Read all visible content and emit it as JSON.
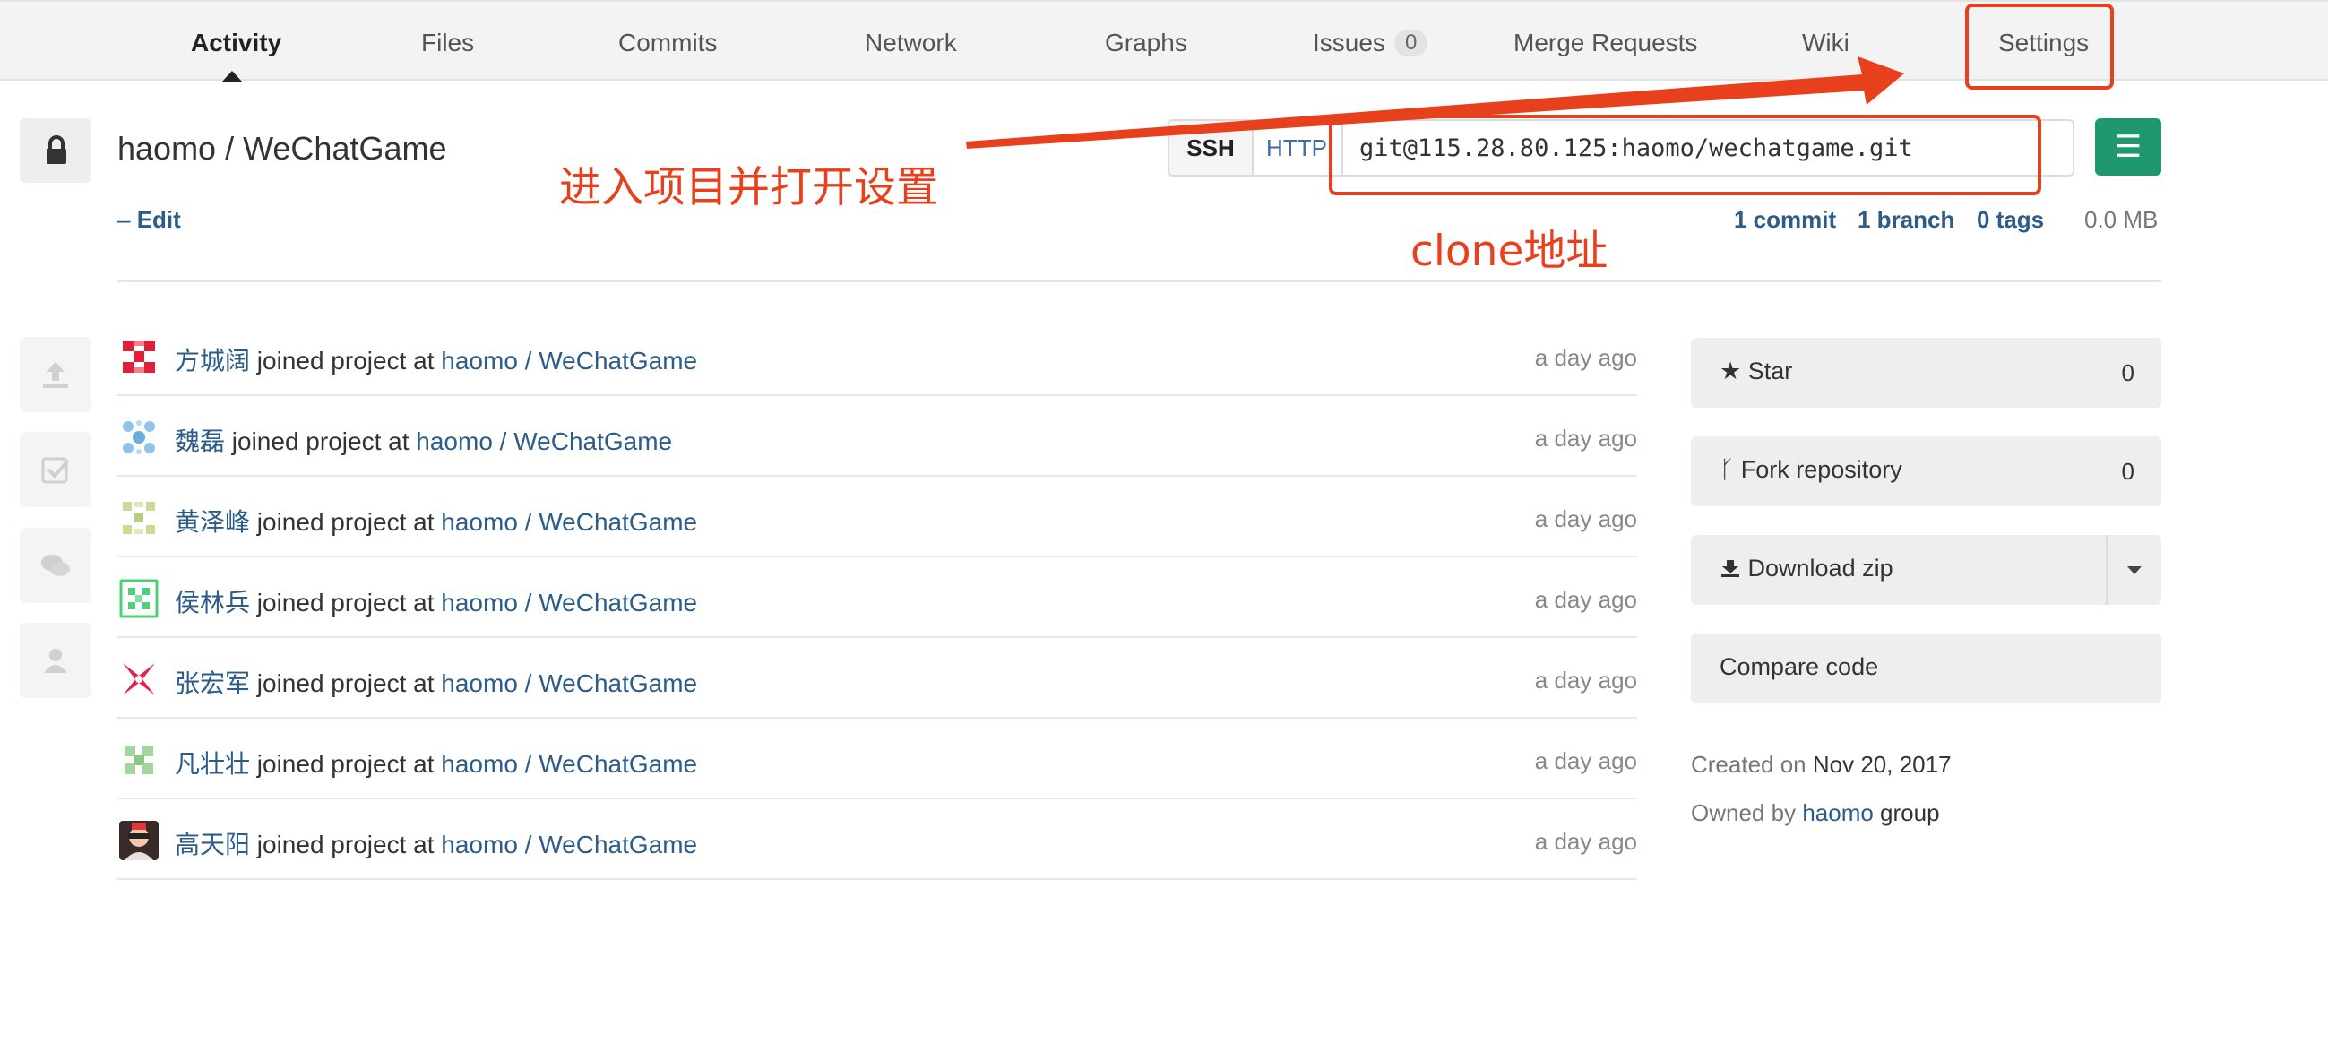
{
  "nav": {
    "tabs": [
      "Activity",
      "Files",
      "Commits",
      "Network",
      "Graphs",
      "Issues",
      "Merge Requests",
      "Wiki",
      "Settings"
    ],
    "active": "Activity",
    "issues_count": "0"
  },
  "project": {
    "title": "haomo / WeChatGame",
    "edit_dash": "–",
    "edit_label": "Edit"
  },
  "clone": {
    "ssh_label": "SSH",
    "http_label": "HTTP",
    "url": "git@115.28.80.125:haomo/wechatgame.git",
    "menu_icon": "☰"
  },
  "stats": {
    "commits": "1 commit",
    "branches": "1 branch",
    "tags": "0 tags",
    "size": "0.0 MB"
  },
  "annotations": {
    "open_settings": "进入项目并打开设置",
    "clone_address": "clone地址",
    "color": "#e8401c"
  },
  "sidebar_icons": [
    "upload-icon",
    "check-square-icon",
    "comments-icon",
    "user-icon"
  ],
  "events": [
    {
      "user": "方城阔",
      "action": "joined project",
      "at": "at",
      "project": "haomo / WeChatGame",
      "time": "a day ago"
    },
    {
      "user": "魏磊",
      "action": "joined project",
      "at": "at",
      "project": "haomo / WeChatGame",
      "time": "a day ago"
    },
    {
      "user": "黄泽峰",
      "action": "joined project",
      "at": "at",
      "project": "haomo / WeChatGame",
      "time": "a day ago"
    },
    {
      "user": "侯林兵",
      "action": "joined project",
      "at": "at",
      "project": "haomo / WeChatGame",
      "time": "a day ago"
    },
    {
      "user": "张宏军",
      "action": "joined project",
      "at": "at",
      "project": "haomo / WeChatGame",
      "time": "a day ago"
    },
    {
      "user": "凡壮壮",
      "action": "joined project",
      "at": "at",
      "project": "haomo / WeChatGame",
      "time": "a day ago"
    },
    {
      "user": "高天阳",
      "action": "joined project",
      "at": "at",
      "project": "haomo / WeChatGame",
      "time": "a day ago"
    }
  ],
  "panel": {
    "star_label": "Star",
    "star_count": "0",
    "fork_label": "Fork repository",
    "fork_count": "0",
    "download_label": "Download zip",
    "compare_label": "Compare code",
    "created_prefix": "Created on",
    "created_date": "Nov 20, 2017",
    "owned_prefix": "Owned by",
    "owner": "haomo",
    "owned_suffix": "group"
  },
  "colors": {
    "link": "#2c5c8a",
    "accent_green": "#1f9870",
    "annotation_red": "#e8401c"
  }
}
